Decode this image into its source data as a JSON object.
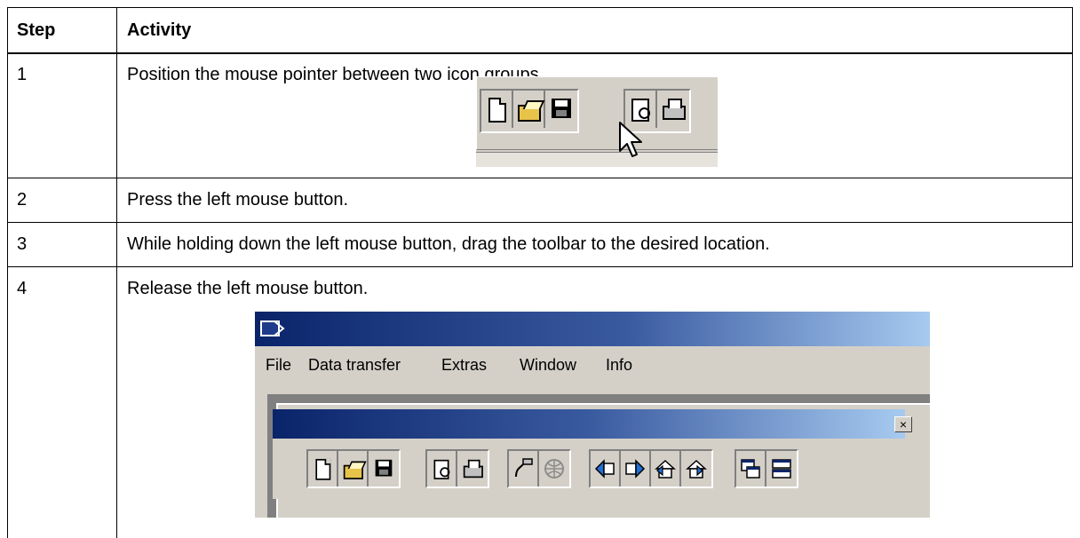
{
  "table": {
    "header": {
      "step": "Step",
      "activity": "Activity"
    },
    "rows": [
      {
        "step": "1",
        "activity": "Position the mouse pointer between two icon groups."
      },
      {
        "step": "2",
        "activity": "Press the left mouse button."
      },
      {
        "step": "3",
        "activity": "While holding down the left mouse button, drag the toolbar to the desired location."
      },
      {
        "step": "4",
        "activity": "Release the left mouse button."
      }
    ]
  },
  "screenshot1": {
    "icons": [
      "new-document-icon",
      "open-folder-icon",
      "save-disk-icon",
      "print-preview-icon",
      "printer-icon",
      "mouse-pointer-icon"
    ]
  },
  "screenshot2": {
    "menu": [
      "File",
      "Data transfer",
      "Extras",
      "Window",
      "Info"
    ],
    "close_glyph": "×",
    "colors": {
      "title_start": "#0a246a",
      "title_end": "#a6caf0",
      "face": "#d4d0c8"
    },
    "toolbar_icons": [
      "new-document-icon",
      "open-folder-icon",
      "save-disk-icon",
      "print-preview-icon",
      "printer-icon",
      "transfer-icon",
      "disabled-globe-icon",
      "receive-icon",
      "send-icon",
      "upload-icon",
      "download-icon",
      "cascade-windows-icon",
      "tile-windows-icon"
    ]
  }
}
